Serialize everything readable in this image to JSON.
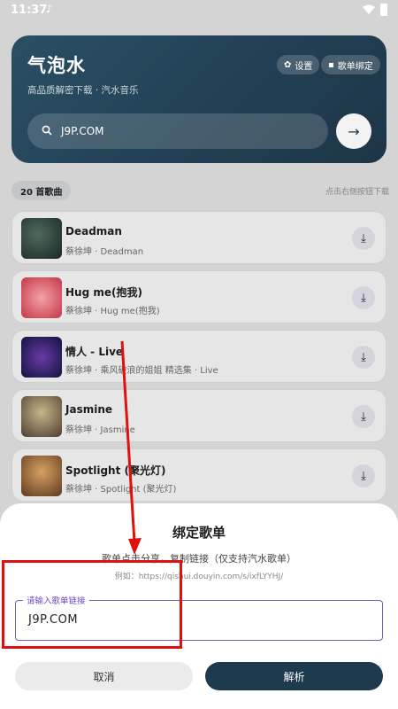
{
  "status": {
    "time": "11:37",
    "music_icon": "music-note-icon"
  },
  "hero": {
    "title": "气泡水",
    "subtitle": "高品质解密下载 · 汽水音乐",
    "settings_label": "设置",
    "bind_label": "歌单绑定",
    "search_value": "J9P.COM",
    "go_icon": "arrow-right-icon"
  },
  "list": {
    "count_label": "20 首歌曲",
    "hint": "点击右侧按钮下载",
    "songs": [
      {
        "name": "Deadman",
        "artist": "蔡徐坤 · Deadman"
      },
      {
        "name": "Hug me(抱我)",
        "artist": "蔡徐坤 · Hug me(抱我)"
      },
      {
        "name": "情人 - Live",
        "artist": "蔡徐坤 · 乘风破浪的姐姐 精选集 · Live"
      },
      {
        "name": "Jasmine",
        "artist": "蔡徐坤 · Jasmine"
      },
      {
        "name": "Spotlight (聚光灯)",
        "artist": "蔡徐坤 · Spotlight (聚光灯)"
      }
    ]
  },
  "sheet": {
    "title": "绑定歌单",
    "description": "歌单点击分享，复制链接（仅支持汽水歌单）",
    "example": "例如：https://qishui.douyin.com/s/ixfLYYHJ/",
    "field_label": "请输入歌单链接",
    "field_value": "J9P.COM",
    "cancel_label": "取消",
    "parse_label": "解析"
  },
  "colors": {
    "accent": "#1d3a4f",
    "annotation": "#e01010",
    "field_border": "#7a5cb3"
  }
}
